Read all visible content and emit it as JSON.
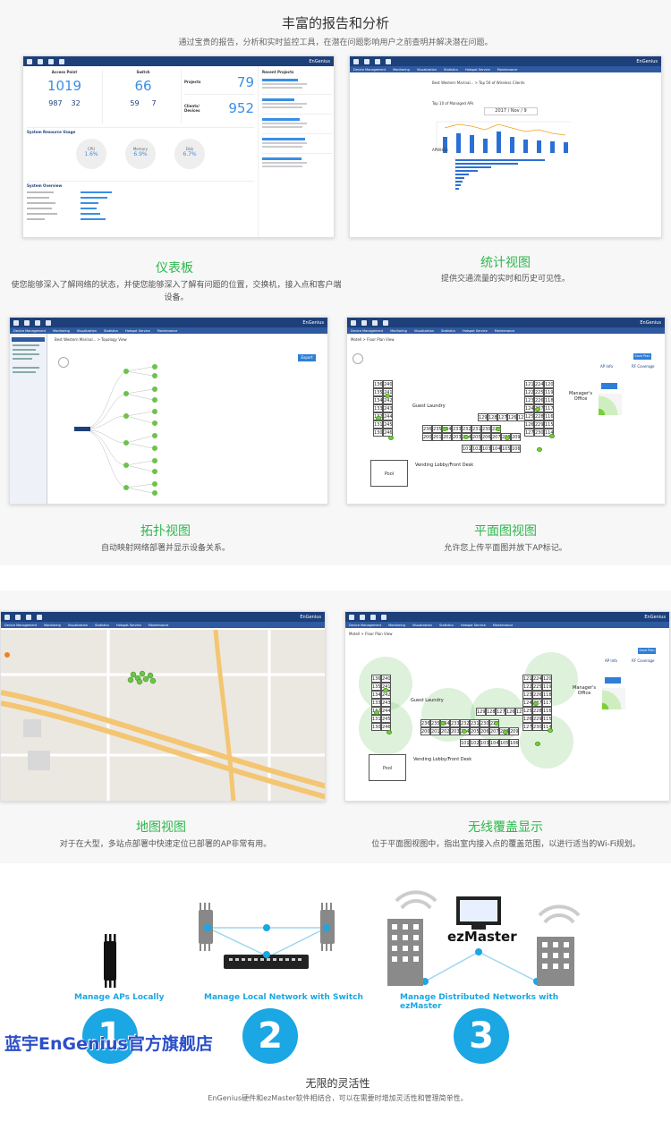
{
  "intro": {
    "heading": "丰富的报告和分析",
    "subheading": "通过宝贵的报告，分析和实时监控工具，在潜在问题影响用户之前查明并解决潜在问题。"
  },
  "screens": {
    "brand": "EnGenius",
    "menu": [
      "Device Management",
      "Monitoring",
      "Visualization",
      "Statistics",
      "Hotspot Service",
      "Maintenance"
    ],
    "dashboard": {
      "ap_title": "Access Point",
      "ap_total": "1019",
      "ap_online": "987",
      "ap_offline": "32",
      "switch_title": "Switch",
      "switch_total": "66",
      "switch_online": "59",
      "switch_offline": "7",
      "projects_label": "Projects",
      "projects_value": "79",
      "clients_label": "Clients/ Devices",
      "clients_value": "952",
      "recent_projects": "Recent Projects",
      "usage_title": "System Resource Usage",
      "cpu_label": "CPU",
      "cpu_value": "1.6%",
      "mem_label": "Memory",
      "mem_value": "6.9%",
      "disk_label": "Disk",
      "disk_value": "6.7%",
      "overview_title": "System Overview"
    },
    "stats": {
      "title": "Best Western Marinal... > Top 50 of Wireless Clients",
      "chart1_title": "Top 10 of Managed APs",
      "chart1_date": "2017 / Nov / 9",
      "chart2_title": "APWH1G"
    },
    "topology": {
      "title": "Best Western Marinal... > Topology View",
      "export": "Export"
    },
    "floorplan": {
      "title": "Motell > Floor Plan View",
      "save": "Save Plan",
      "ap_info": "AP Info",
      "coverage": "RF Coverage",
      "office": "Manager's Office",
      "laundry": "Guest Laundry",
      "pool": "Pool",
      "lobby": "Vending   Lobby/Front Desk"
    }
  },
  "features": [
    {
      "title": "仪表板",
      "desc": "使您能够深入了解网络的状态，并使您能够深入了解有问题的位置，交换机，接入点和客户端设备。"
    },
    {
      "title": "统计视图",
      "desc": "提供交通流量的实时和历史可见性。"
    },
    {
      "title": "拓扑视图",
      "desc": "自动映射网络部署并显示设备关系。"
    },
    {
      "title": "平面图视图",
      "desc": "允许您上传平面图并放下AP标记。"
    },
    {
      "title": "地图视图",
      "desc": "对于在大型，多站点部署中快速定位已部署的AP非常有用。"
    },
    {
      "title": "无线覆盖显示",
      "desc": "位于平面图视图中，指出室内接入点的覆盖范围，以进行适当的Wi-Fi规划。"
    }
  ],
  "rooms": {
    "left": [
      "240",
      "241",
      "242",
      "243",
      "244",
      "245",
      "246"
    ],
    "left2": [
      "136",
      "135",
      "134",
      "133",
      "132",
      "131",
      "130"
    ],
    "mid_top": [
      "129",
      "128",
      "127",
      "126",
      "125"
    ],
    "mid_row2": [
      "236",
      "235",
      "234",
      "233",
      "232",
      "231",
      "230",
      "229"
    ],
    "mid_row3": [
      "200",
      "201",
      "202",
      "203",
      "204",
      "205",
      "206",
      "207",
      "208",
      "209"
    ],
    "mid_row4": [
      "101",
      "102",
      "103",
      "104",
      "105",
      "106"
    ],
    "right_a": [
      "121",
      "122",
      "123",
      "124",
      "125",
      "126",
      "127"
    ],
    "right_b": [
      "224",
      "225",
      "226",
      "227",
      "228",
      "229",
      "230"
    ],
    "right_c": [
      "120",
      "119",
      "118",
      "117",
      "116",
      "115",
      "114"
    ]
  },
  "flex": {
    "step1": "1",
    "step2": "2",
    "step3": "3",
    "cap1": "Manage APs Locally",
    "cap2": "Manage Local Network with Switch",
    "cap3": "Manage Distributed Networks with ezMaster",
    "ezmaster": "ezMaster",
    "heading": "无限的灵活性",
    "sub": "EnGenius硬件和ezMaster软件相结合，可以在需要时增加灵活性和管理简单性。",
    "watermark": "蓝宇EnGenius官方旗舰店"
  },
  "colors": {
    "accent_green": "#2eb84c",
    "accent_blue": "#1ba6e4",
    "navbar": "#1d3f7a"
  }
}
